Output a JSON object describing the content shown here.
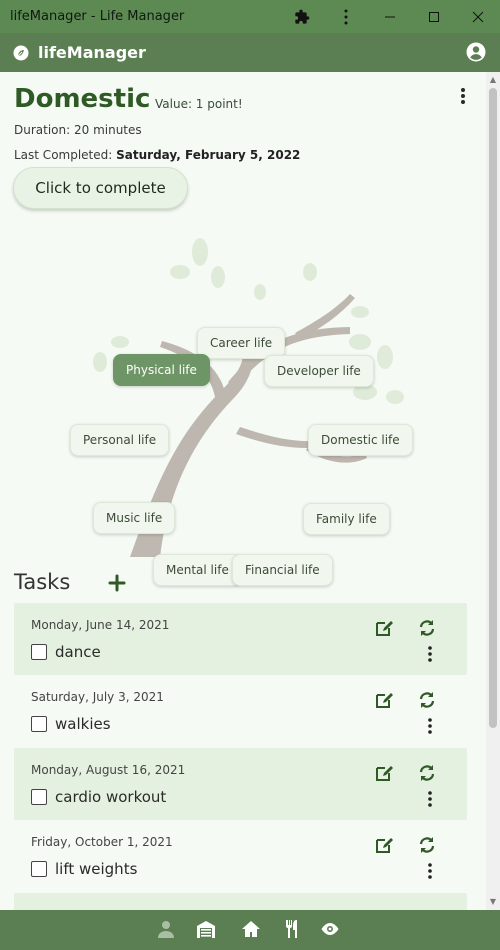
{
  "window": {
    "title": "lifeManager - Life Manager"
  },
  "appbar": {
    "app_name": "lifeManager"
  },
  "activity": {
    "title": "Domestic",
    "value_text": "Value: 1 point!",
    "duration_label": "Duration: ",
    "duration_value": "20 minutes",
    "last_completed_label": "Last Completed: ",
    "last_completed_value": "Saturday, February 5, 2022",
    "complete_button": "Click to complete"
  },
  "life_areas": [
    {
      "label": "Career life",
      "active": false
    },
    {
      "label": "Physical life",
      "active": true
    },
    {
      "label": "Developer life",
      "active": false
    },
    {
      "label": "Personal life",
      "active": false
    },
    {
      "label": "Domestic life",
      "active": false
    },
    {
      "label": "Music life",
      "active": false
    },
    {
      "label": "Family life",
      "active": false
    },
    {
      "label": "Mental life",
      "active": false
    },
    {
      "label": "Financial life",
      "active": false
    }
  ],
  "tasks_section": {
    "heading": "Tasks",
    "items": [
      {
        "date": "Monday, June 14, 2021",
        "name": "dance",
        "checked": false
      },
      {
        "date": "Saturday, July 3, 2021",
        "name": "walkies",
        "checked": false
      },
      {
        "date": "Monday, August 16, 2021",
        "name": "cardio workout",
        "checked": false
      },
      {
        "date": "Friday, October 1, 2021",
        "name": "lift weights",
        "checked": false
      }
    ]
  },
  "bottom_nav": [
    "person-icon",
    "garage-icon",
    "home-icon",
    "restaurant-icon",
    "eye-icon"
  ],
  "colors": {
    "titlebar": "#5d8a53",
    "appbar": "#5b7f52",
    "accent_dark": "#2f5a26",
    "task_shade": "#e5f1e0",
    "chip_active": "#6e9565"
  }
}
